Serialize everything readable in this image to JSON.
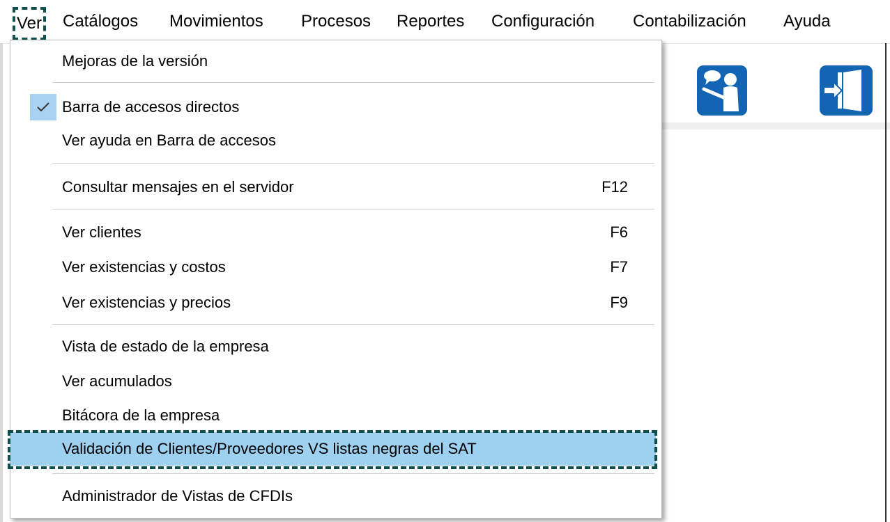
{
  "menubar": {
    "items": [
      "Ver",
      "Catálogos",
      "Movimientos",
      "Procesos",
      "Reportes",
      "Configuración",
      "Contabilización",
      "Ayuda"
    ]
  },
  "toolbar": {
    "buttons": [
      {
        "icon": "presenter-help-icon"
      },
      {
        "icon": "exit-door-icon"
      }
    ]
  },
  "dropdown": {
    "items": [
      {
        "label": "Mejoras de la versión",
        "shortcut": ""
      },
      {
        "label": "Barra de accesos directos",
        "shortcut": "",
        "checked": true
      },
      {
        "label": "Ver ayuda en Barra de accesos",
        "shortcut": ""
      },
      {
        "label": "Consultar mensajes en el servidor",
        "shortcut": "F12"
      },
      {
        "label": "Ver clientes",
        "shortcut": "F6"
      },
      {
        "label": "Ver existencias y costos",
        "shortcut": "F7"
      },
      {
        "label": "Ver existencias y precios",
        "shortcut": "F9"
      },
      {
        "label": "Vista de estado de la empresa",
        "shortcut": ""
      },
      {
        "label": "Ver acumulados",
        "shortcut": ""
      },
      {
        "label": "Bitácora de la empresa",
        "shortcut": ""
      },
      {
        "label": "Validación de Clientes/Proveedores VS listas negras del SAT",
        "shortcut": "",
        "highlighted": true
      },
      {
        "label": "Administrador de Vistas de CFDIs",
        "shortcut": ""
      }
    ]
  },
  "colors": {
    "highlight": "#9ed0f0",
    "dashed_frame": "#0f4f4d",
    "icon_blue": "#1464b4",
    "check_bg": "#a9d2f2"
  }
}
